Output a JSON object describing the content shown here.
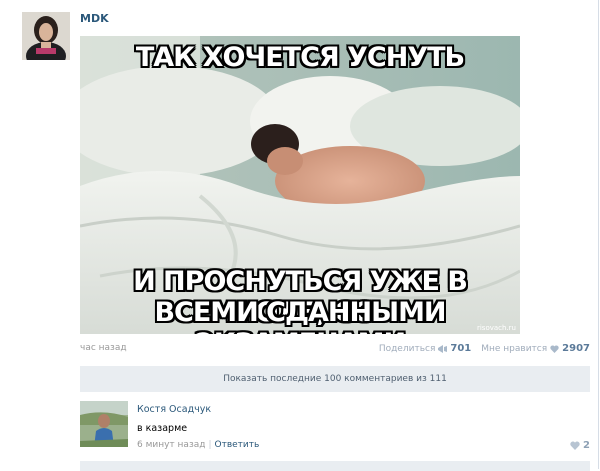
{
  "post": {
    "author": "MDK",
    "meme": {
      "top_text": "ТАК ХОЧЕТСЯ УСНУТЬ",
      "bottom_text_line1": "И ПРОСНУТЬСЯ УЖЕ В ИЮЛЕ, СО",
      "bottom_text_line2": "ВСЕМИ СДАННЫМИ ЭКЗАМЕНАМИ",
      "watermark": "risovach.ru"
    },
    "time": "час назад",
    "share_label": "Поделиться",
    "share_count": "701",
    "like_label": "Мне нравится",
    "like_count": "2907"
  },
  "comments": {
    "show_more_label": "Показать последние 100 комментариев из 111",
    "items": [
      {
        "author": "Костя Осадчук",
        "text": "в казарме",
        "time": "6 минут назад",
        "reply_label": "Ответить",
        "likes": "2"
      }
    ]
  },
  "colors": {
    "link": "#2b587a",
    "muted": "#999999",
    "bar_bg": "#e9edf1"
  }
}
